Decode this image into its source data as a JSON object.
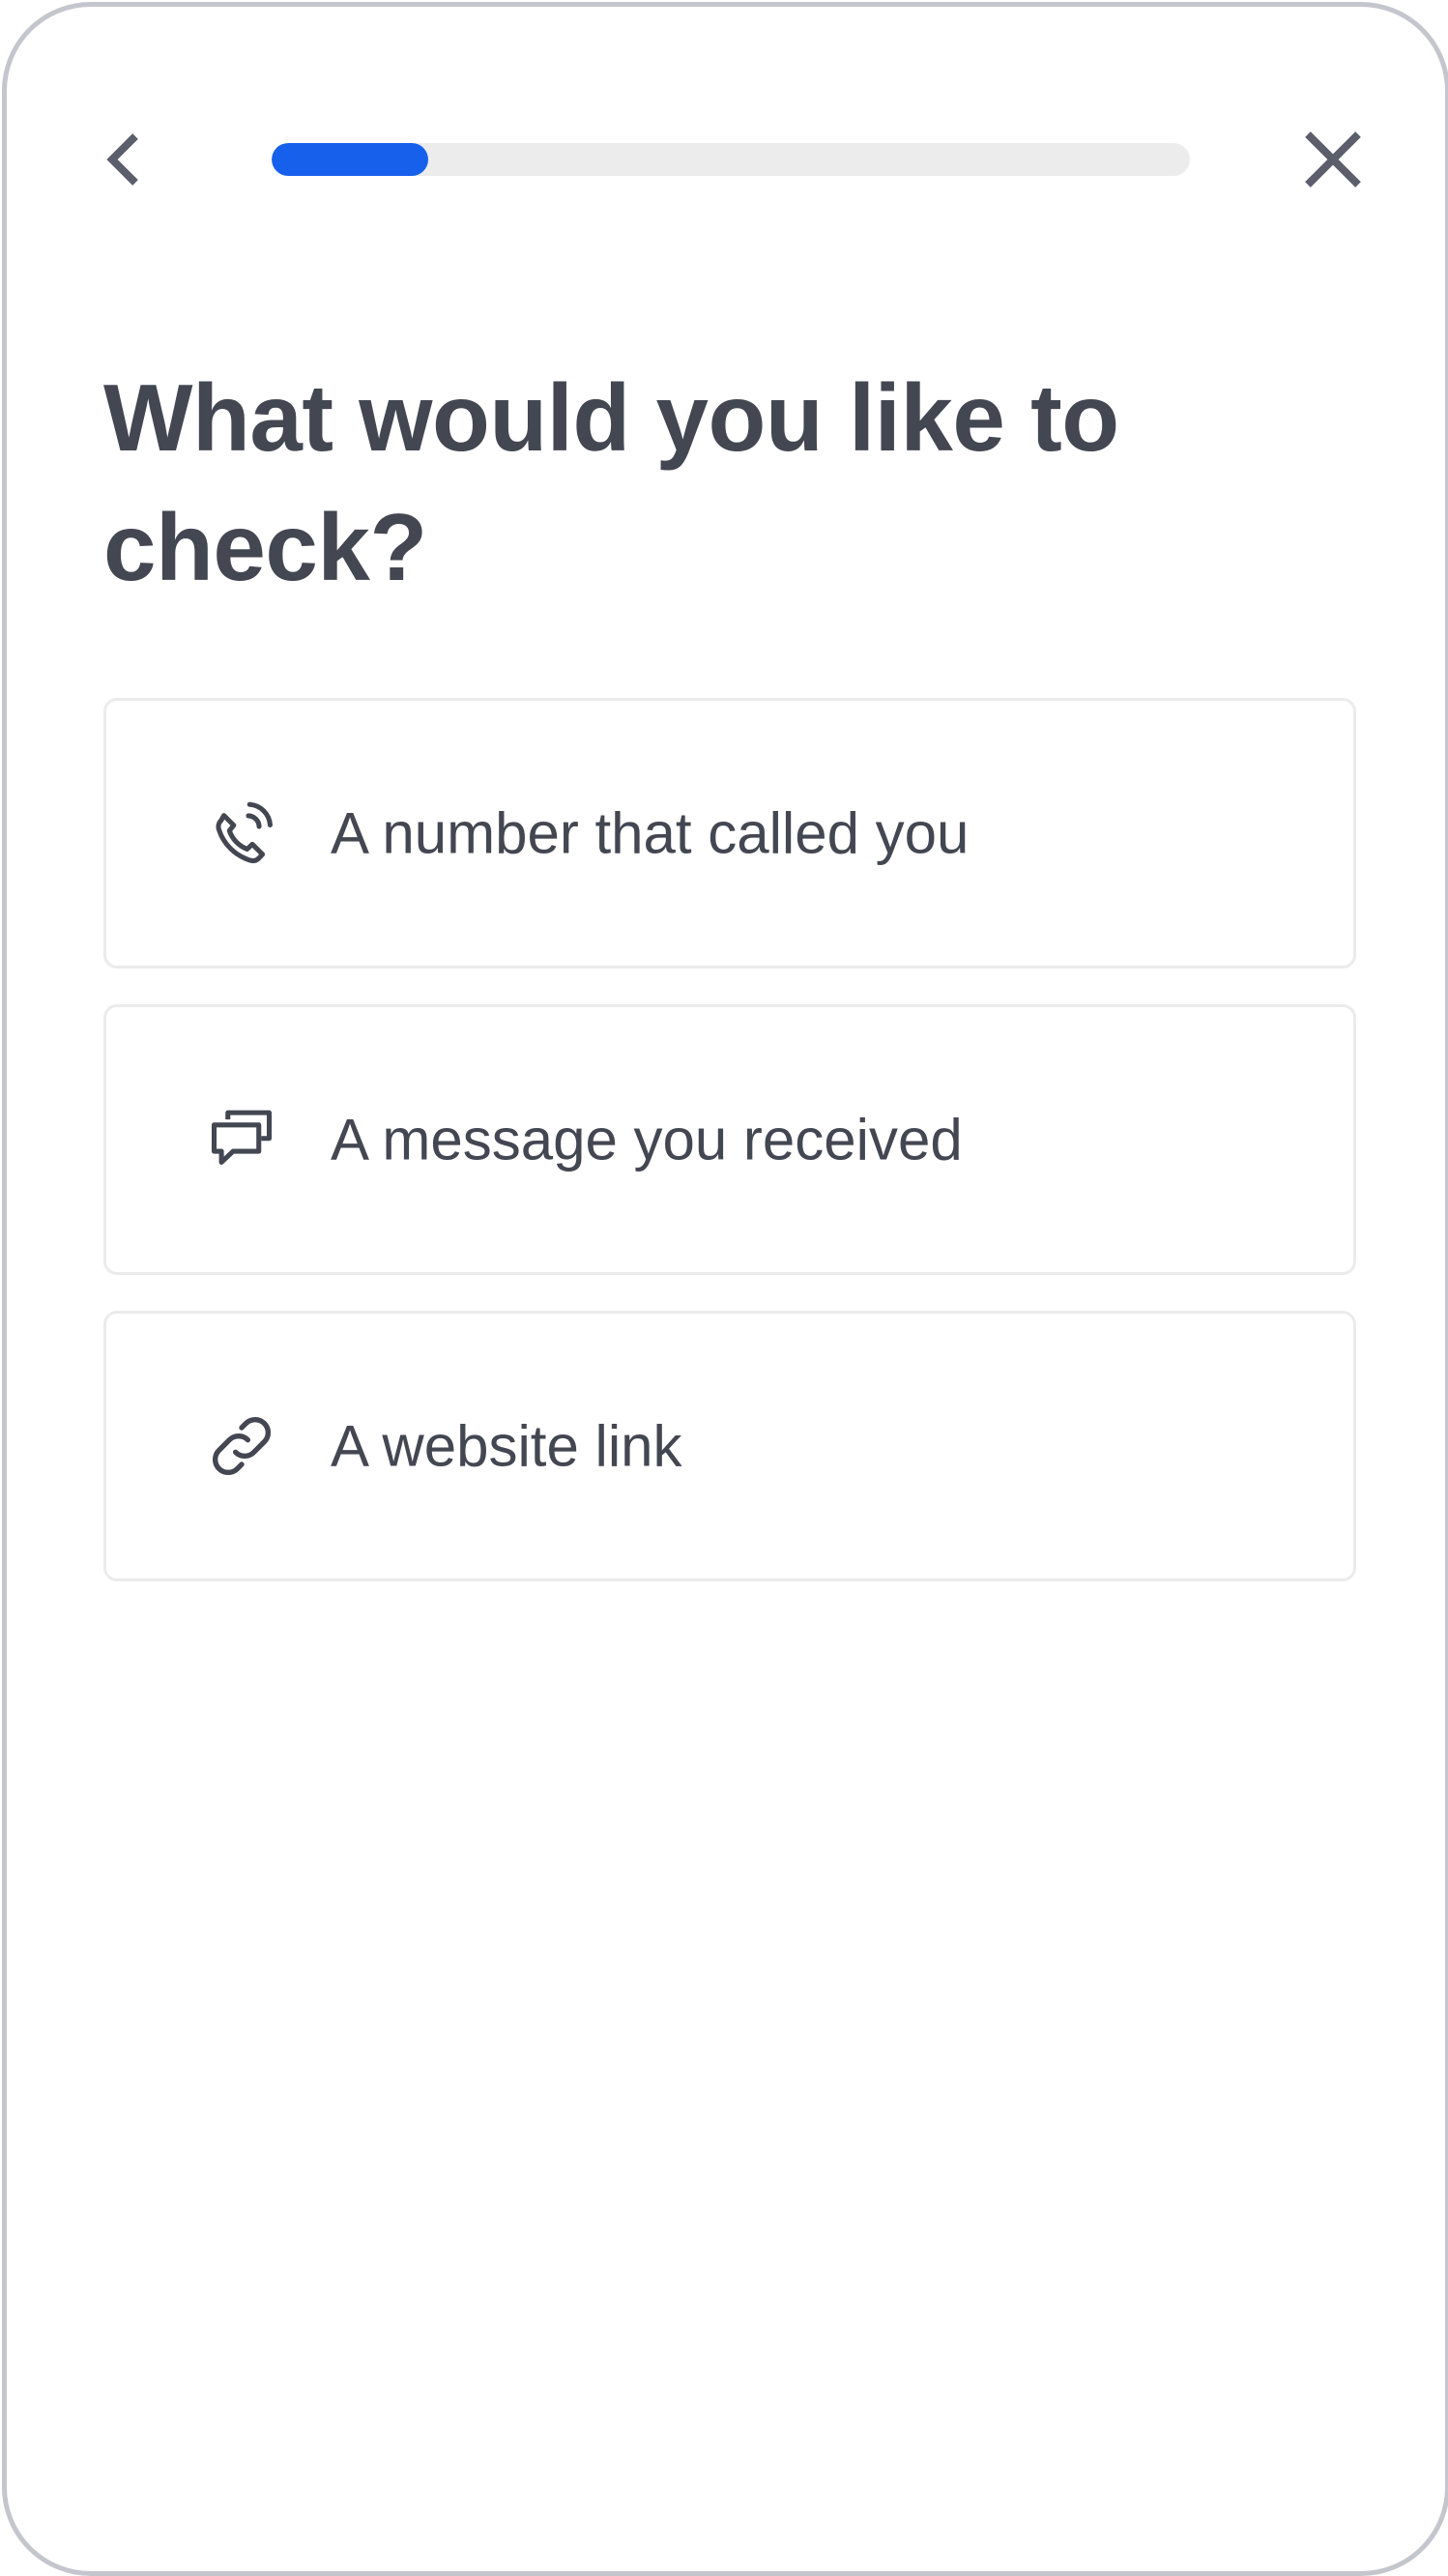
{
  "header": {
    "back_icon": "chevron-left-icon",
    "close_icon": "close-icon",
    "progress": {
      "fraction": 0.17,
      "color": "#1760ec",
      "track_color": "#ececec"
    }
  },
  "main": {
    "title": "What would you like to check?",
    "options": [
      {
        "label": "A number that called you",
        "icon": "phone-call-icon"
      },
      {
        "label": "A message you received",
        "icon": "chat-bubbles-icon"
      },
      {
        "label": "A website link",
        "icon": "link-icon"
      }
    ]
  }
}
